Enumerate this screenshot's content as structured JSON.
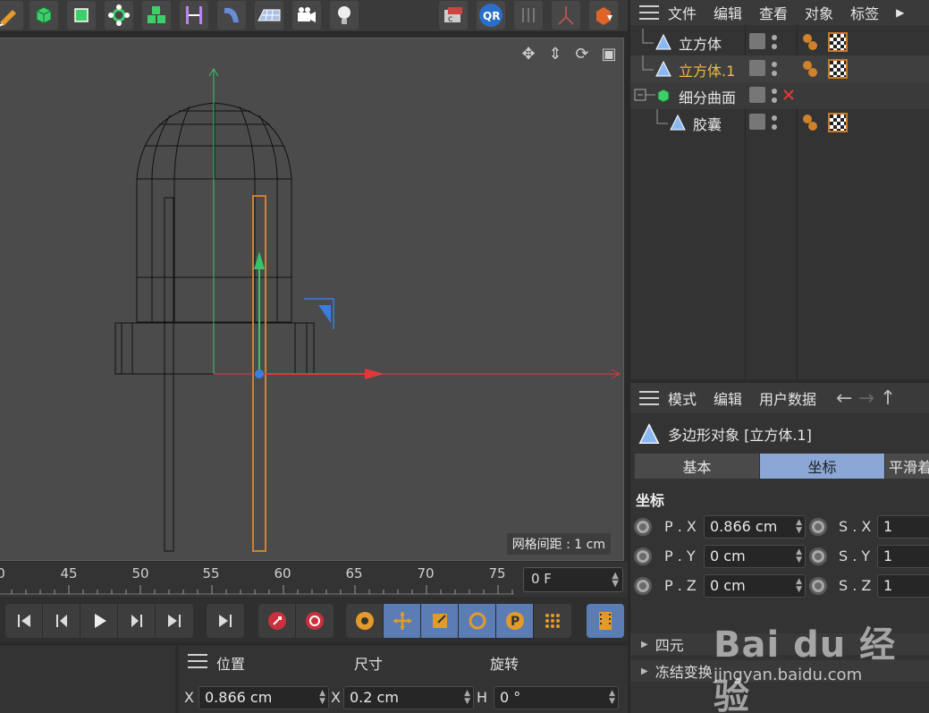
{
  "object_manager": {
    "menu": [
      "文件",
      "编辑",
      "查看",
      "对象",
      "标签"
    ],
    "objects": [
      {
        "name": "立方体",
        "active": false
      },
      {
        "name": "立方体.1",
        "active": true
      },
      {
        "name": "细分曲面",
        "active": false
      },
      {
        "name": "胶囊",
        "active": false
      }
    ]
  },
  "attributes": {
    "menu": [
      "模式",
      "编辑",
      "用户数据"
    ],
    "title": "多边形对象 [立方体.1]",
    "tabs": [
      "基本",
      "坐标",
      "平滑着"
    ],
    "active_tab": "坐标",
    "section": "坐标",
    "fields": {
      "px_label": "P . X",
      "px": "0.866 cm",
      "py_label": "P . Y",
      "py": "0 cm",
      "pz_label": "P . Z",
      "pz": "0 cm",
      "sx_label": "S . X",
      "sx": "1",
      "sy_label": "S . Y",
      "sy": "1",
      "sz_label": "S . Z",
      "sz": "1"
    },
    "collapsed": [
      "四元",
      "冻结变换"
    ]
  },
  "viewport": {
    "grid_label": "网格间距 : 1 cm"
  },
  "timeline": {
    "ticks": [
      "0",
      "45",
      "50",
      "55",
      "60",
      "65",
      "70",
      "75"
    ],
    "frame": "0 F"
  },
  "coordinates": {
    "col_position": "位置",
    "col_size": "尺寸",
    "col_rotation": "旋转",
    "x_label": "X",
    "x_value": "0.866 cm",
    "size_x_label": "X",
    "size_x_value": "0.2 cm",
    "h_label": "H",
    "h_value": "0 °"
  },
  "watermark": {
    "logo": "Bai du 经验",
    "url": "jingyan.baidu.com"
  },
  "colors": {
    "accent": "#8aa7d6",
    "active_object": "#f4b942",
    "selection_orange": "#d0822a",
    "axis_x": "#e0383a",
    "axis_y": "#39c26a",
    "axis_z": "#3a7de0"
  }
}
